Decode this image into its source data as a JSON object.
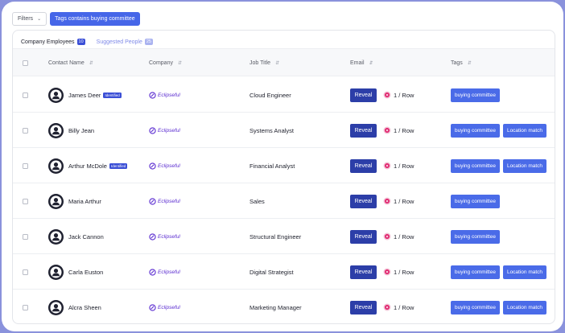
{
  "filterbar": {
    "filters_label": "Filters",
    "active_filter": "Tags contains buying committee"
  },
  "tabs": [
    {
      "label": "Company Employees",
      "count": "10",
      "active": true
    },
    {
      "label": "Suggested People",
      "count": "25",
      "active": false
    }
  ],
  "columns": {
    "contact_name": "Contact Name",
    "company": "Company",
    "job_title": "Job Title",
    "email": "Email",
    "tags": "Tags"
  },
  "labels": {
    "reveal": "Reveal",
    "credit": "1 / Row",
    "identified": "Identified"
  },
  "rows": [
    {
      "name": "James Deer",
      "identified": true,
      "company": "Eclipseful",
      "job": "Cloud Engineer",
      "tags": [
        "buying committee"
      ]
    },
    {
      "name": "Billy Jean",
      "identified": false,
      "company": "Eclipseful",
      "job": "Systems Analyst",
      "tags": [
        "buying committee",
        "Location match"
      ]
    },
    {
      "name": "Arthur McDole",
      "identified": true,
      "company": "Eclipseful",
      "job": "Financial Analyst",
      "tags": [
        "buying committee",
        "Location match"
      ]
    },
    {
      "name": "Maria Arthur",
      "identified": false,
      "company": "Eclipseful",
      "job": "Sales",
      "tags": [
        "buying committee"
      ]
    },
    {
      "name": "Jack Cannon",
      "identified": false,
      "company": "Eclipseful",
      "job": "Structural Engineer",
      "tags": [
        "buying committee"
      ]
    },
    {
      "name": "Carla Euston",
      "identified": false,
      "company": "Eclipseful",
      "job": "Digital Strategist",
      "tags": [
        "buying committee",
        "Location match"
      ]
    },
    {
      "name": "Alcra Sheen",
      "identified": false,
      "company": "Eclipseful",
      "job": "Marketing Manager",
      "tags": [
        "buying committee",
        "Location match"
      ]
    }
  ],
  "colors": {
    "primary": "#4a6be8",
    "reveal": "#2c3ea8",
    "company": "#5a2bd0",
    "tab_underline": "#e0206b",
    "credit_icon": "#e0206b"
  },
  "icons": {
    "filter_chevron": "chevron-down-icon",
    "sort": "sort-icon",
    "avatar": "user-avatar-icon",
    "company_logo": "eclipseful-logo-icon",
    "credit": "credit-coin-icon"
  }
}
